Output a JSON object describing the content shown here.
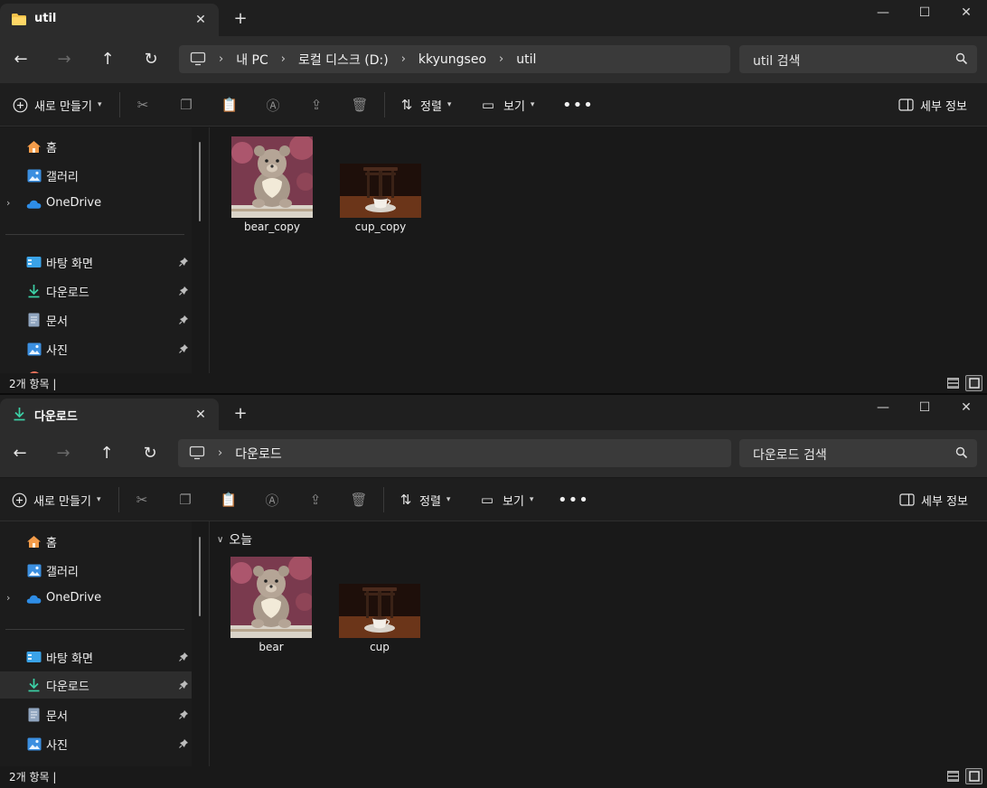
{
  "windows": [
    {
      "tab_title": "util",
      "tab_icon": "folder-icon",
      "breadcrumb": [
        "내 PC",
        "로컬 디스크 (D:)",
        "kkyungseo",
        "util"
      ],
      "search_placeholder": "util 검색",
      "group_header": null,
      "files": [
        {
          "name": "bear_copy",
          "thumbnail": "bear-image-thumbnail"
        },
        {
          "name": "cup_copy",
          "thumbnail": "cup-image-thumbnail"
        }
      ],
      "status": "2개 항목  |",
      "active_sidebar": null
    },
    {
      "tab_title": "다운로드",
      "tab_icon": "download-icon",
      "breadcrumb": [
        "다운로드"
      ],
      "search_placeholder": "다운로드 검색",
      "group_header": "오늘",
      "files": [
        {
          "name": "bear",
          "thumbnail": "bear-image-thumbnail"
        },
        {
          "name": "cup",
          "thumbnail": "cup-image-thumbnail"
        }
      ],
      "status": "2개 항목  |",
      "active_sidebar": "다운로드"
    }
  ],
  "toolbar": {
    "new_label": "새로 만들기",
    "sort_label": "정렬",
    "view_label": "보기",
    "details_label": "세부 정보"
  },
  "sidebar": {
    "top": [
      {
        "label": "홈",
        "icon": "home-icon"
      },
      {
        "label": "갤러리",
        "icon": "gallery-icon"
      },
      {
        "label": "OneDrive",
        "icon": "onedrive-cloud-icon"
      }
    ],
    "pinned": [
      {
        "label": "바탕 화면",
        "icon": "desktop-icon"
      },
      {
        "label": "다운로드",
        "icon": "download-icon"
      },
      {
        "label": "문서",
        "icon": "document-icon"
      },
      {
        "label": "사진",
        "icon": "pictures-icon"
      }
    ]
  },
  "colors": {
    "background": "#191919",
    "chrome": "#2c2c2c",
    "accent_blue": "#4cc2ff",
    "folder_yellow": "#f5c34b",
    "download_green": "#3ccfa5"
  }
}
